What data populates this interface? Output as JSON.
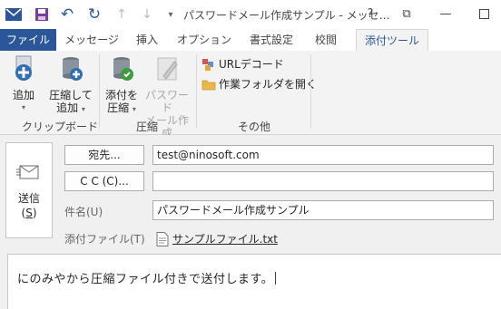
{
  "window": {
    "title": "パスワードメール作成サンプル - メッセ…",
    "help_glyph": "?",
    "restore_glyph": "⧉",
    "minimize_glyph": "—"
  },
  "tabs": [
    {
      "label": "ファイル"
    },
    {
      "label": "メッセージ"
    },
    {
      "label": "挿入"
    },
    {
      "label": "オプション"
    },
    {
      "label": "書式設定"
    },
    {
      "label": "校閲"
    },
    {
      "label": "添付ツール"
    }
  ],
  "ribbon": {
    "clipboard": {
      "add_label": "追加",
      "compress_add_line1": "圧縮して",
      "compress_add_line2": "追加",
      "group_label": "クリップボード"
    },
    "compress": {
      "compress_attach_line1": "添付を",
      "compress_attach_line2": "圧縮",
      "password_mail_line1": "パスワード",
      "password_mail_line2": "メール作成",
      "group_label": "圧縮"
    },
    "other": {
      "url_decode": "URLデコード",
      "open_work_folder": "作業フォルダを開く",
      "group_label": "その他"
    }
  },
  "compose": {
    "send_label": "送信",
    "send_shortcut": "S",
    "to_button": "宛先...",
    "cc_button": "C C (C)...",
    "to_value": "test@ninosoft.com",
    "cc_value": "",
    "subject_label": "件名(U)",
    "subject_value": "パスワードメール作成サンプル",
    "attachment_label": "添付ファイル(T)",
    "attachment_name": "サンプルファイル.txt",
    "body_text": "にのみやから圧縮ファイル付きで送付します。"
  },
  "colors": {
    "accent": "#2b579a",
    "ribbon_bg": "#f3f3f3",
    "compose_bg": "#f0f0f0"
  }
}
